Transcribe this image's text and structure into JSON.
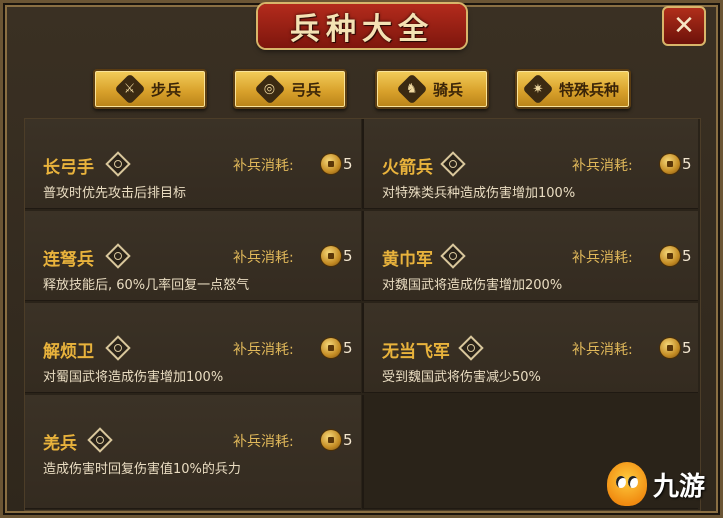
{
  "window": {
    "title": "兵种大全",
    "close_label": "✕"
  },
  "tabs": [
    {
      "label": "步兵",
      "icon": "infantry-icon",
      "glyph": "⚔"
    },
    {
      "label": "弓兵",
      "icon": "bow-icon",
      "glyph": "◎"
    },
    {
      "label": "骑兵",
      "icon": "cavalry-icon",
      "glyph": "♞"
    },
    {
      "label": "特殊兵种",
      "icon": "special-icon",
      "glyph": "✷"
    }
  ],
  "units": [
    {
      "name": "长弓手",
      "cost_label": "补兵消耗:",
      "cost": "5",
      "desc": "普攻时优先攻击后排目标"
    },
    {
      "name": "火箭兵",
      "cost_label": "补兵消耗:",
      "cost": "5",
      "desc": "对特殊类兵种造成伤害增加100%"
    },
    {
      "name": "连弩兵",
      "cost_label": "补兵消耗:",
      "cost": "5",
      "desc": "释放技能后, 60%几率回复一点怒气"
    },
    {
      "name": "黄巾军",
      "cost_label": "补兵消耗:",
      "cost": "5",
      "desc": "对魏国武将造成伤害增加200%"
    },
    {
      "name": "解烦卫",
      "cost_label": "补兵消耗:",
      "cost": "5",
      "desc": "对蜀国武将造成伤害增加100%"
    },
    {
      "name": "无当飞军",
      "cost_label": "补兵消耗:",
      "cost": "5",
      "desc": "受到魏国武将伤害减少50%"
    },
    {
      "name": "羌兵",
      "cost_label": "补兵消耗:",
      "cost": "5",
      "desc": "造成伤害时回复伤害值10%的兵力"
    }
  ],
  "watermark": {
    "text": "九游"
  },
  "colors": {
    "accent_gold": "#e9b33c",
    "banner_red": "#b32b1c"
  }
}
